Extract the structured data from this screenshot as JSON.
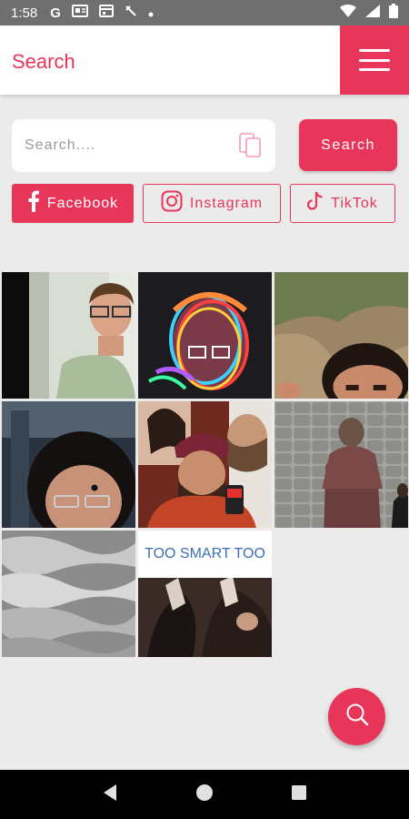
{
  "status_bar": {
    "time": "1:58",
    "left_icons": [
      "google-icon",
      "news-icon",
      "calendar-icon",
      "tool-icon",
      "dot-icon"
    ],
    "right_icons": [
      "wifi-icon",
      "signal-icon",
      "battery-icon"
    ]
  },
  "app_bar": {
    "title": "Search",
    "menu_icon": "hamburger-menu-icon"
  },
  "search": {
    "placeholder": "Search....",
    "value": "",
    "paste_icon": "clipboard-icon",
    "button_label": "Search"
  },
  "platforms": [
    {
      "label": "Facebook",
      "icon": "facebook-icon",
      "active": true
    },
    {
      "label": "Instagram",
      "icon": "instagram-icon",
      "active": false
    },
    {
      "label": "TikTok",
      "icon": "tiktok-icon",
      "active": false
    }
  ],
  "gif_results": [
    {
      "caption": ""
    },
    {
      "caption": ""
    },
    {
      "caption": ""
    },
    {
      "caption": ""
    },
    {
      "caption": ""
    },
    {
      "caption": ""
    },
    {
      "caption": ""
    },
    {
      "caption": "TOO SMART TOO"
    }
  ],
  "fab": {
    "icon": "search-icon"
  },
  "nav_bar": {
    "icons": [
      "back-icon",
      "home-icon",
      "recents-icon"
    ]
  },
  "colors": {
    "accent": "#e8365a",
    "background": "#ebebeb"
  }
}
